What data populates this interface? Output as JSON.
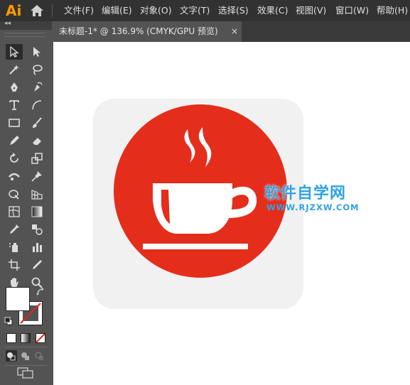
{
  "app": {
    "logo": "Ai"
  },
  "menu": {
    "items": [
      "文件(F)",
      "编辑(E)",
      "对象(O)",
      "文字(T)",
      "选择(S)",
      "效果(C)",
      "视图(V)",
      "窗口(W)",
      "帮助(H)"
    ]
  },
  "toolbar": {
    "collapse_label": "◂◂"
  },
  "document": {
    "tab_title": "未标题-1* @ 136.9% (CMYK/GPU 预览)",
    "close_label": "×"
  },
  "artwork": {
    "background_color": "#f1f1f1",
    "circle_color": "#e52d1c",
    "cup_color": "#ffffff"
  },
  "watermark": {
    "title": "软件自学网",
    "url": "WWW.RJZXW.COM",
    "color": "#2fa3e6"
  },
  "colors": {
    "menubar": "#323232",
    "panel": "#535353",
    "accent_logo": "#ff9a00"
  }
}
